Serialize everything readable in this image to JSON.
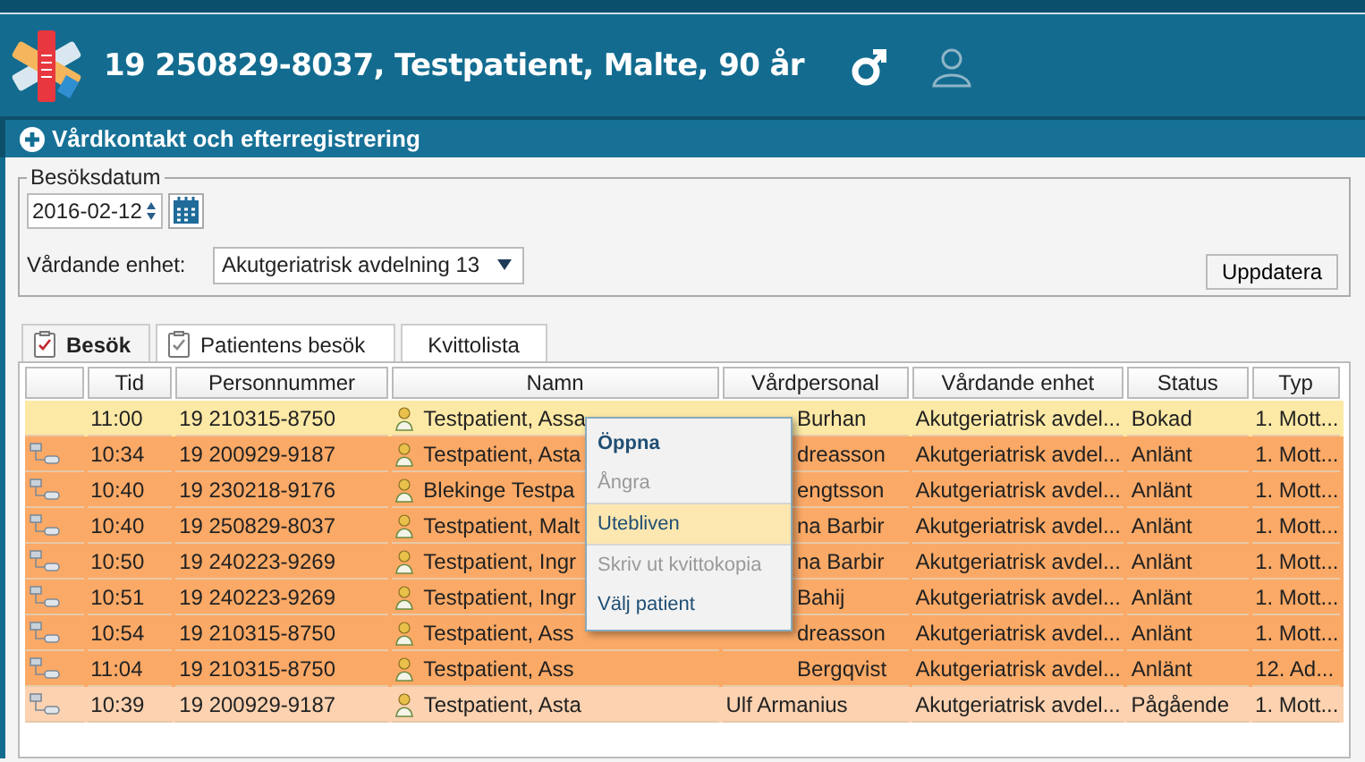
{
  "header": {
    "title": "19 250829-8037,  Testpatient, Malte,  90 år"
  },
  "section": {
    "title": "Vårdkontakt och efterregistrering"
  },
  "filter": {
    "legend": "Besöksdatum",
    "date": "2016-02-12",
    "unit_label": "Vårdande enhet:",
    "unit_value": "Akutgeriatrisk avdelning 13",
    "button": "Uppdatera"
  },
  "tabs": [
    {
      "label": "Besök",
      "selected": true,
      "icon": true
    },
    {
      "label": "Patientens besök",
      "selected": false,
      "icon": true
    },
    {
      "label": "Kvittolista",
      "selected": false,
      "icon": false
    }
  ],
  "table": {
    "columns": [
      "Tid",
      "Personnummer",
      "Namn",
      "Vårdpersonal",
      "Vårdande enhet",
      "Status",
      "Typ"
    ],
    "rows": [
      {
        "kind": "booked",
        "linked": false,
        "staff_covered": true,
        "cells": [
          "11:00",
          "19 210315-8750",
          "Testpatient, Assa",
          "Burhan",
          "Akutgeriatrisk avdel...",
          "Bokad",
          "1. Mott..."
        ]
      },
      {
        "kind": "arrived",
        "linked": true,
        "staff_covered": true,
        "cells": [
          "10:34",
          "19 200929-9187",
          "Testpatient, Asta",
          "dreasson",
          "Akutgeriatrisk avdel...",
          "Anlänt",
          "1. Mott..."
        ]
      },
      {
        "kind": "arrived",
        "linked": true,
        "staff_covered": true,
        "cells": [
          "10:40",
          "19 230218-9176",
          "Blekinge Testpa",
          "engtsson",
          "Akutgeriatrisk avdel...",
          "Anlänt",
          "1. Mott..."
        ]
      },
      {
        "kind": "arrived",
        "linked": true,
        "staff_covered": true,
        "cells": [
          "10:40",
          "19 250829-8037",
          "Testpatient, Malt",
          "na Barbir",
          "Akutgeriatrisk avdel...",
          "Anlänt",
          "1. Mott..."
        ]
      },
      {
        "kind": "arrived",
        "linked": true,
        "staff_covered": true,
        "cells": [
          "10:50",
          "19 240223-9269",
          "Testpatient, Ingr",
          "na Barbir",
          "Akutgeriatrisk avdel...",
          "Anlänt",
          "1. Mott..."
        ]
      },
      {
        "kind": "arrived",
        "linked": true,
        "staff_covered": true,
        "cells": [
          "10:51",
          "19 240223-9269",
          "Testpatient, Ingr",
          "Bahij",
          "Akutgeriatrisk avdel...",
          "Anlänt",
          "1. Mott..."
        ]
      },
      {
        "kind": "arrived",
        "linked": true,
        "staff_covered": true,
        "cells": [
          "10:54",
          "19 210315-8750",
          "Testpatient, Ass",
          "dreasson",
          "Akutgeriatrisk avdel...",
          "Anlänt",
          "1. Mott..."
        ]
      },
      {
        "kind": "arrived",
        "linked": true,
        "staff_covered": true,
        "cells": [
          "11:04",
          "19 210315-8750",
          "Testpatient, Ass",
          "Bergqvist",
          "Akutgeriatrisk avdel...",
          "Anlänt",
          "12. Ad..."
        ]
      },
      {
        "kind": "ongoing",
        "linked": true,
        "staff_covered": false,
        "cells": [
          "10:39",
          "19 200929-9187",
          "Testpatient, Asta",
          "Ulf Armanius",
          "Akutgeriatrisk avdel...",
          "Pågående",
          "1. Mott..."
        ]
      }
    ]
  },
  "context_menu": [
    {
      "label": "Öppna",
      "kind": "default",
      "disabled": false,
      "highlighted": false,
      "separator_before": false
    },
    {
      "label": "Ångra",
      "kind": "normal",
      "disabled": true,
      "highlighted": false,
      "separator_before": false
    },
    {
      "label": "Utebliven",
      "kind": "normal",
      "disabled": false,
      "highlighted": true,
      "separator_before": true
    },
    {
      "label": "Skriv ut kvittokopia",
      "kind": "normal",
      "disabled": true,
      "highlighted": false,
      "separator_before": true
    },
    {
      "label": "Välj patient",
      "kind": "normal",
      "disabled": false,
      "highlighted": false,
      "separator_before": false
    }
  ]
}
